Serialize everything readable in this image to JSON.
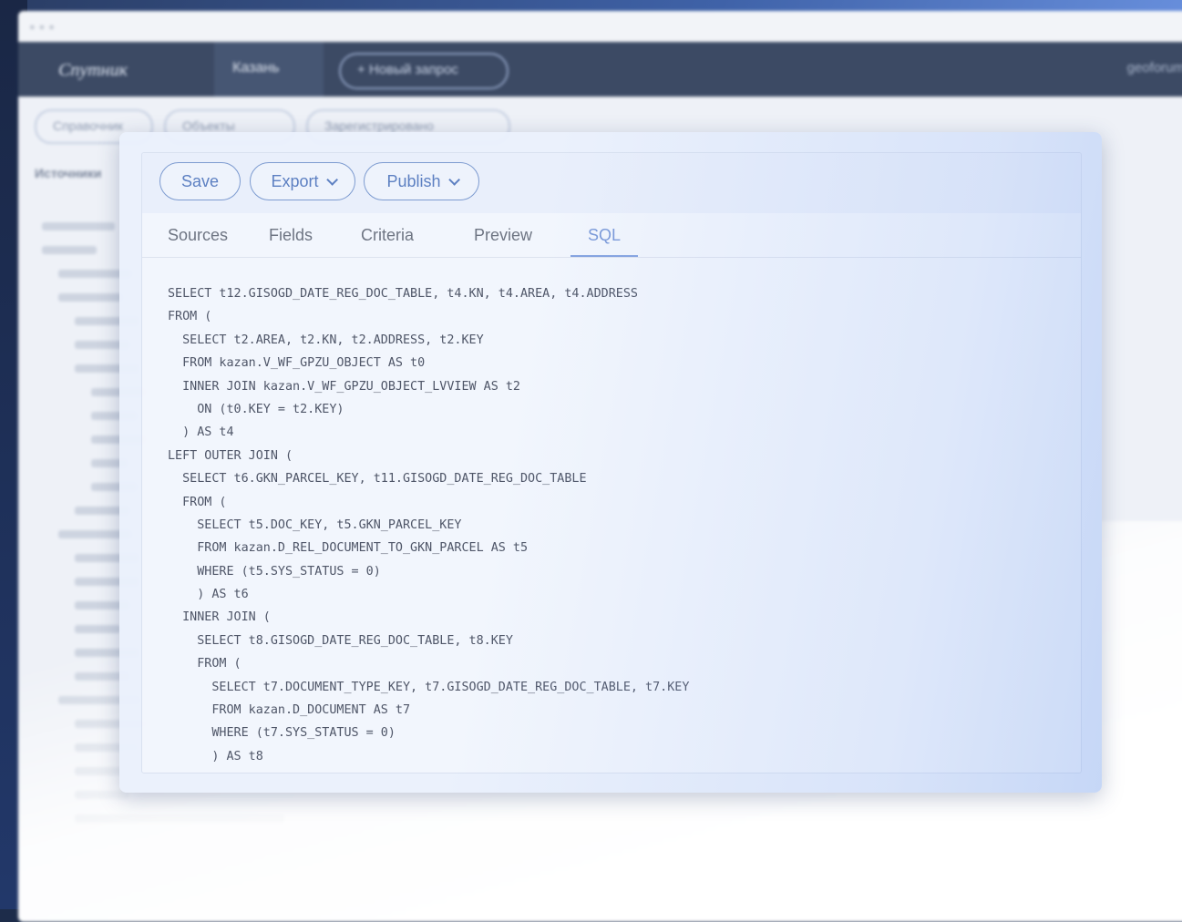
{
  "background_window": {
    "app_logo": "Спутник",
    "menu_label": "Казань",
    "new_query_label": "+ Новый запрос",
    "user_label": "geoforum",
    "chips": [
      "Справочник",
      "Объекты",
      "Зарегистрировано"
    ],
    "side_title": "Источники"
  },
  "toolbar": {
    "save_label": "Save",
    "export_label": "Export",
    "publish_label": "Publish"
  },
  "tabs": [
    {
      "label": "Sources"
    },
    {
      "label": "Fields"
    },
    {
      "label": "Criteria"
    },
    {
      "label": "Preview"
    },
    {
      "label": "SQL",
      "active": true
    }
  ],
  "sql_lines": [
    "SELECT t12.GISOGD_DATE_REG_DOC_TABLE, t4.KN, t4.AREA, t4.ADDRESS",
    "FROM (",
    "  SELECT t2.AREA, t2.KN, t2.ADDRESS, t2.KEY",
    "  FROM kazan.V_WF_GPZU_OBJECT AS t0",
    "  INNER JOIN kazan.V_WF_GPZU_OBJECT_LVVIEW AS t2",
    "    ON (t0.KEY = t2.KEY)",
    "  ) AS t4",
    "LEFT OUTER JOIN (",
    "  SELECT t6.GKN_PARCEL_KEY, t11.GISOGD_DATE_REG_DOC_TABLE",
    "  FROM (",
    "    SELECT t5.DOC_KEY, t5.GKN_PARCEL_KEY",
    "    FROM kazan.D_REL_DOCUMENT_TO_GKN_PARCEL AS t5",
    "    WHERE (t5.SYS_STATUS = 0)",
    "    ) AS t6",
    "  INNER JOIN (",
    "    SELECT t8.GISOGD_DATE_REG_DOC_TABLE, t8.KEY",
    "    FROM (",
    "      SELECT t7.DOCUMENT_TYPE_KEY, t7.GISOGD_DATE_REG_DOC_TABLE, t7.KEY",
    "      FROM kazan.D_DOCUMENT AS t7",
    "      WHERE (t7.SYS_STATUS = 0)",
    "      ) AS t8"
  ],
  "colors": {
    "accent": "#7a99d8",
    "pill_border": "#7d9bd0",
    "code_text": "#4f5668",
    "tab_text": "#6e7583"
  }
}
